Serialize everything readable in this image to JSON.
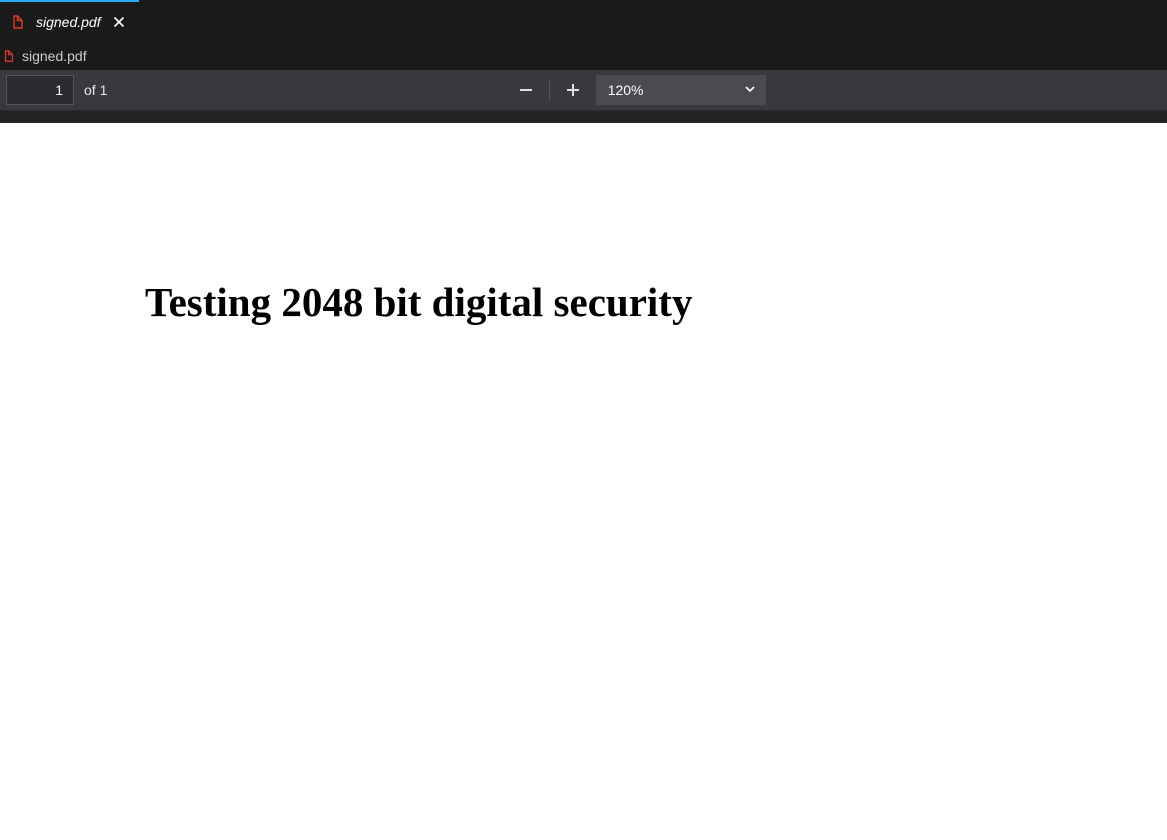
{
  "tab": {
    "title": "signed.pdf"
  },
  "filename_bar": {
    "title": "signed.pdf"
  },
  "toolbar": {
    "page_current": "1",
    "page_of": "of 1",
    "zoom_level": "120%"
  },
  "document": {
    "heading": "Testing 2048 bit digital security"
  }
}
